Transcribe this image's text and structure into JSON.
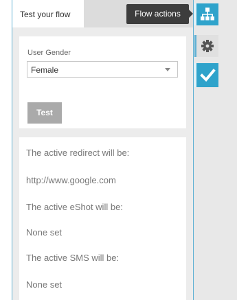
{
  "tabs": {
    "active_label": "Test your flow"
  },
  "tooltip": {
    "text": "Flow actions"
  },
  "form": {
    "field_label": "User Gender",
    "select_value": "Female",
    "test_button_label": "Test"
  },
  "results": {
    "redirect_label": "The active redirect will be:",
    "redirect_value": "http://www.google.com",
    "eshot_label": "The active eShot will be:",
    "eshot_value": "None set",
    "sms_label": "The active SMS will be:",
    "sms_value": "None set"
  },
  "rail": {
    "icons": [
      "flow-actions-icon",
      "settings-gear-icon",
      "checkmark-icon"
    ]
  },
  "colors": {
    "accent": "#2fa3cb",
    "accent_border": "#5fb1d4",
    "tooltip_bg": "#3d3d3d",
    "button_gray": "#aaaaaa"
  }
}
